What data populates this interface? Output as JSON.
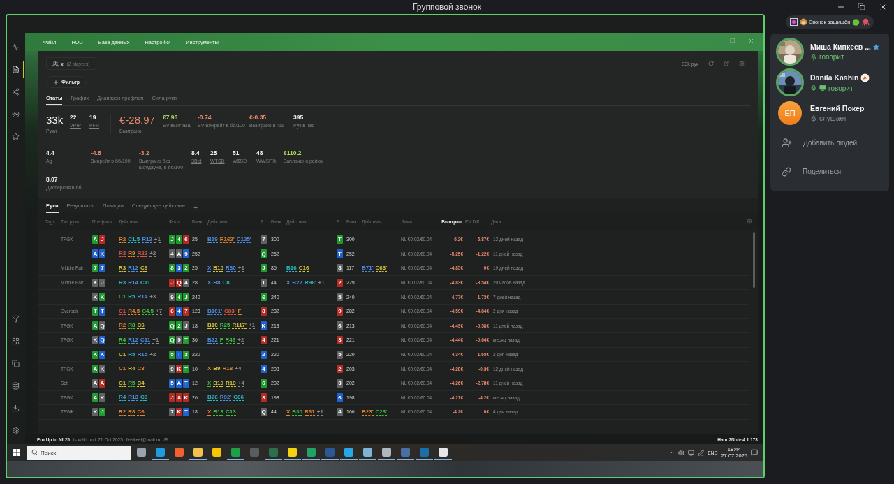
{
  "window": {
    "title": "Групповой звонок"
  },
  "sidebar": [
    {
      "kind": "chart",
      "selected": false
    },
    {
      "kind": "document",
      "selected": true
    },
    {
      "kind": "share",
      "selected": false
    },
    {
      "kind": "radio",
      "selected": false
    },
    {
      "kind": "star",
      "selected": false
    },
    {
      "kind": "filter",
      "selected": false
    },
    {
      "kind": "grid",
      "selected": false
    },
    {
      "kind": "copy",
      "selected": false
    },
    {
      "kind": "database",
      "selected": false
    },
    {
      "kind": "download",
      "selected": false
    },
    {
      "kind": "settings",
      "selected": false
    }
  ],
  "app": {
    "menu": [
      "Файл",
      "HUD",
      "База данных",
      "Настройки",
      "Инструменты"
    ],
    "player": {
      "name": "к.",
      "count": "(2 players)"
    },
    "hands_count": "33k рук",
    "filter_button": "Фильтр",
    "tabs": [
      {
        "label": "Статы",
        "selected": true
      },
      {
        "label": "График",
        "selected": false
      },
      {
        "label": "Диапазон префлоп",
        "selected": false
      },
      {
        "label": "Сила руки",
        "selected": false
      }
    ],
    "stats_rows": [
      [
        [
          {
            "value": "33k",
            "label": "Руки",
            "large": true,
            "color": "#f0f0f0",
            "underlined": false
          },
          {
            "value": "22",
            "label": "VPIP",
            "large": false,
            "color": "#f0f0f0",
            "underlined": true
          },
          {
            "value": "19",
            "label": "PFR",
            "large": false,
            "color": "#f0f0f0",
            "underlined": true
          }
        ],
        [
          {
            "value": "€-28.97",
            "label": "Выиграно",
            "large": true,
            "color": "#e8876c",
            "underlined": false
          },
          {
            "value": "€7.96",
            "label": "EV выигрыш",
            "large": false,
            "color": "#a8d95a",
            "underlined": false
          },
          {
            "value": "-0.74",
            "label": "EV Винрейт в бб/100",
            "large": false,
            "color": "#e8876c",
            "underlined": false
          },
          {
            "value": "€-0.35",
            "label": "Выиграно в час",
            "large": false,
            "color": "#e8876c",
            "underlined": false
          },
          {
            "value": "395",
            "label": "Рук в час",
            "large": false,
            "color": "#f0f0f0",
            "underlined": false
          }
        ]
      ],
      [
        [
          {
            "value": "4.4",
            "label": "Ag",
            "large": false,
            "color": "#f0f0f0",
            "underlined": false
          },
          {
            "value": "-4.8",
            "label": "Винрейт в бб/100",
            "large": false,
            "color": "#e8876c",
            "underlined": false
          },
          {
            "value": "-3.2",
            "label": "Выиграно без шоудауна, в бб/100",
            "large": false,
            "color": "#e8876c",
            "underlined": false
          },
          {
            "value": "8.4",
            "label": "3Bet",
            "large": false,
            "color": "#f0f0f0",
            "underlined": true
          },
          {
            "value": "28",
            "label": "WTSD",
            "large": false,
            "color": "#f0f0f0",
            "underlined": true
          },
          {
            "value": "51",
            "label": "W$SD",
            "large": false,
            "color": "#f0f0f0",
            "underlined": false
          },
          {
            "value": "48",
            "label": "WWSF%",
            "large": false,
            "color": "#f0f0f0",
            "underlined": false
          },
          {
            "value": "€110.2",
            "label": "Заплачено рейка",
            "large": false,
            "color": "#a8d95a",
            "underlined": false
          }
        ]
      ],
      [
        [
          {
            "value": "8.07",
            "label": "Дисперсия в бб",
            "large": false,
            "color": "#f0f0f0",
            "underlined": false
          }
        ]
      ]
    ]
  },
  "table": {
    "tabs": [
      {
        "label": "Руки",
        "selected": true
      },
      {
        "label": "Результаты",
        "selected": false
      },
      {
        "label": "Позиции",
        "selected": false
      },
      {
        "label": "Следующее действие",
        "selected": false
      }
    ],
    "add_tab": "+",
    "columns": [
      {
        "label": "Tags",
        "sorted": false
      },
      {
        "label": "Тип руки",
        "sorted": false
      },
      {
        "label": "Префлоп",
        "sorted": false
      },
      {
        "label": "Действия",
        "sorted": false
      },
      {
        "label": "Флоп",
        "sorted": false
      },
      {
        "label": "Банк",
        "sorted": false
      },
      {
        "label": "Действия",
        "sorted": false
      },
      {
        "label": "Т.",
        "sorted": false
      },
      {
        "label": "Банк",
        "sorted": false
      },
      {
        "label": "Действия",
        "sorted": false
      },
      {
        "label": "Р.",
        "sorted": false
      },
      {
        "label": "Банк",
        "sorted": false
      },
      {
        "label": "Действия",
        "sorted": false
      },
      {
        "label": "Лимит",
        "sorted": false
      },
      {
        "label": "Выиграл ↓",
        "sorted": true
      },
      {
        "label": "EV Diff",
        "sorted": false
      },
      {
        "label": "Дата",
        "sorted": false
      }
    ],
    "rows": [
      {
        "type": "TPGK",
        "hole": [
          {
            "rank": "A",
            "color": "#1f9a2e"
          },
          {
            "rank": "J",
            "color": "#b52a22"
          }
        ],
        "pre": [
          {
            "text": "R2",
            "color": "#e0842f"
          },
          {
            "text": "C1.5",
            "color": "#27b8c8"
          },
          {
            "text": "R12",
            "color": "#4d8ee6"
          },
          {
            "text": "+1",
            "color": "#8a8a8a"
          }
        ],
        "flop": [
          {
            "rank": "J",
            "color": "#1f9a2e"
          },
          {
            "rank": "4",
            "color": "#1f9a2e"
          },
          {
            "rank": "6",
            "color": "#b52a22"
          }
        ],
        "flop_pot": "25",
        "flop_act": [
          {
            "text": "B19",
            "color": "#4d8ee6"
          },
          {
            "text": "R162'",
            "color": "#e0842f"
          },
          {
            "text": "C125'",
            "color": "#4d8ee6"
          }
        ],
        "turn": {
          "rank": "7",
          "color": "#5f6163"
        },
        "turn_pot": "300",
        "river": {
          "rank": "T",
          "color": "#1f9a2e"
        },
        "river_pot": "300",
        "limit": "NL €0.02/€0.04",
        "won": "-6.2€",
        "ev_diff": "-6.87€",
        "date": "12 дней назад"
      },
      {
        "hole": [
          {
            "rank": "A",
            "color": "#1f62cf"
          },
          {
            "rank": "K",
            "color": "#1f62cf"
          }
        ],
        "pre": [
          {
            "text": "R3",
            "color": "#e0533f"
          },
          {
            "text": "R9",
            "color": "#e0842f"
          },
          {
            "text": "R22",
            "color": "#e0533f"
          },
          {
            "text": "+2",
            "color": "#8a8a8a"
          }
        ],
        "flop": [
          {
            "rank": "4",
            "color": "#5f6163"
          },
          {
            "rank": "A",
            "color": "#5f6163"
          },
          {
            "rank": "9",
            "color": "#1f62cf"
          }
        ],
        "flop_pot": "252",
        "turn": {
          "rank": "Q",
          "color": "#1f9a2e"
        },
        "turn_pot": "252",
        "river": {
          "rank": "T",
          "color": "#1f62cf"
        },
        "river_pot": "252",
        "limit": "NL €0.02/€0.04",
        "won": "-5.25€",
        "ev_diff": "-1.22€",
        "date": "11 дней назад"
      },
      {
        "type": "Middle Pair",
        "hole": [
          {
            "rank": "7",
            "color": "#1f9a2e"
          },
          {
            "rank": "7",
            "color": "#1f62cf"
          }
        ],
        "pre": [
          {
            "text": "R3",
            "color": "#d4c437"
          },
          {
            "text": "R12",
            "color": "#4d8ee6"
          },
          {
            "text": "C9",
            "color": "#d4c437"
          }
        ],
        "flop": [
          {
            "rank": "8",
            "color": "#1f9a2e"
          },
          {
            "rank": "3",
            "color": "#1f62cf"
          },
          {
            "rank": "2",
            "color": "#1f9a2e"
          }
        ],
        "flop_pot": "25",
        "flop_act": [
          {
            "text": "X",
            "color": "#4d8ee6"
          },
          {
            "text": "B15",
            "color": "#d4c437"
          },
          {
            "text": "R30",
            "color": "#4d8ee6"
          },
          {
            "text": "+1",
            "color": "#8a8a8a"
          }
        ],
        "turn": {
          "rank": "J",
          "color": "#1f9a2e"
        },
        "turn_pot": "85",
        "turn_act": [
          {
            "text": "B16",
            "color": "#27b8c8"
          },
          {
            "text": "C16",
            "color": "#d4c437"
          }
        ],
        "river": {
          "rank": "8",
          "color": "#5f6163"
        },
        "river_pot": "117",
        "river_act": [
          {
            "text": "B71'",
            "color": "#4d8ee6"
          },
          {
            "text": "C63'",
            "color": "#d4c437"
          }
        ],
        "limit": "NL €0.02/€0.04",
        "won": "-4.85€",
        "ev_diff": "0€",
        "date": "19 дней назад"
      },
      {
        "type": "Middle Pair",
        "hole": [
          {
            "rank": "K",
            "color": "#5f6163"
          },
          {
            "rank": "J",
            "color": "#5f6163"
          }
        ],
        "pre": [
          {
            "text": "R3",
            "color": "#27b8c8"
          },
          {
            "text": "R14",
            "color": "#4d8ee6"
          },
          {
            "text": "C11",
            "color": "#27b8c8"
          }
        ],
        "flop": [
          {
            "rank": "J",
            "color": "#b52a22"
          },
          {
            "rank": "Q",
            "color": "#b52a22"
          },
          {
            "rank": "4",
            "color": "#5f6163"
          }
        ],
        "flop_pot": "28",
        "flop_act": [
          {
            "text": "X",
            "color": "#4d8ee6"
          },
          {
            "text": "B8",
            "color": "#4d8ee6"
          },
          {
            "text": "C8",
            "color": "#27b8c8"
          }
        ],
        "turn": {
          "rank": "T",
          "color": "#5f6163"
        },
        "turn_pot": "44",
        "turn_act": [
          {
            "text": "X",
            "color": "#4d8ee6"
          },
          {
            "text": "B22",
            "color": "#4d8ee6"
          },
          {
            "text": "R98'",
            "color": "#27b8c8"
          },
          {
            "text": "+1",
            "color": "#8a8a8a"
          }
        ],
        "river": {
          "rank": "2",
          "color": "#b52a22"
        },
        "river_pot": "229",
        "limit": "NL €0.02/€0.04",
        "won": "-4.83€",
        "ev_diff": "-3.54€",
        "date": "20 часов назад"
      },
      {
        "hole": [
          {
            "rank": "K",
            "color": "#5f6163"
          },
          {
            "rank": "K",
            "color": "#1f9a2e"
          }
        ],
        "pre": [
          {
            "text": "C1",
            "color": "#3ec03e"
          },
          {
            "text": "R5",
            "color": "#27b8c8"
          },
          {
            "text": "R14",
            "color": "#4d8ee6"
          },
          {
            "text": "+3",
            "color": "#8a8a8a"
          }
        ],
        "flop": [
          {
            "rank": "9",
            "color": "#5f6163"
          },
          {
            "rank": "4",
            "color": "#1f9a2e"
          },
          {
            "rank": "J",
            "color": "#1f9a2e"
          }
        ],
        "flop_pot": "240",
        "turn": {
          "rank": "6",
          "color": "#1f9a2e"
        },
        "turn_pot": "240",
        "river": {
          "rank": "5",
          "color": "#5f6163"
        },
        "river_pot": "240",
        "limit": "NL €0.02/€0.04",
        "won": "-4.77€",
        "ev_diff": "-1.73€",
        "date": "7 дней назад"
      },
      {
        "type": "Overpair",
        "hole": [
          {
            "rank": "T",
            "color": "#1f9a2e"
          },
          {
            "rank": "T",
            "color": "#1f62cf"
          }
        ],
        "pre": [
          {
            "text": "C1",
            "color": "#e0533f"
          },
          {
            "text": "R4.5",
            "color": "#e0842f"
          },
          {
            "text": "C4.5",
            "color": "#3ec03e"
          },
          {
            "text": "+7",
            "color": "#8a8a8a"
          }
        ],
        "flop": [
          {
            "rank": "6",
            "color": "#b52a22"
          },
          {
            "rank": "4",
            "color": "#1f62cf"
          },
          {
            "rank": "7",
            "color": "#b52a22"
          }
        ],
        "flop_pot": "128",
        "flop_act": [
          {
            "text": "B101'",
            "color": "#4d8ee6"
          },
          {
            "text": "C83'",
            "color": "#e0533f"
          },
          {
            "text": "F",
            "color": "#e0842f"
          }
        ],
        "turn": {
          "rank": "8",
          "color": "#b52a22"
        },
        "turn_pot": "282",
        "river": {
          "rank": "9",
          "color": "#b52a22"
        },
        "river_pot": "282",
        "limit": "NL €0.02/€0.04",
        "won": "-4.59€",
        "ev_diff": "-4.84€",
        "date": "2 дня назад"
      },
      {
        "type": "TPGK",
        "hole": [
          {
            "rank": "A",
            "color": "#1f9a2e"
          },
          {
            "rank": "Q",
            "color": "#5f6163"
          }
        ],
        "pre": [
          {
            "text": "R2",
            "color": "#e0842f"
          },
          {
            "text": "R8",
            "color": "#3ec03e"
          },
          {
            "text": "C6",
            "color": "#d4c437"
          }
        ],
        "flop": [
          {
            "rank": "Q",
            "color": "#1f9a2e"
          },
          {
            "rank": "2",
            "color": "#1f9a2e"
          },
          {
            "rank": "J",
            "color": "#5f6163"
          }
        ],
        "flop_pot": "18",
        "flop_act": [
          {
            "text": "B10",
            "color": "#d4c437"
          },
          {
            "text": "R25",
            "color": "#3ec03e"
          },
          {
            "text": "R117'",
            "color": "#d4c437"
          },
          {
            "text": "+1",
            "color": "#8a8a8a"
          }
        ],
        "turn": {
          "rank": "K",
          "color": "#1f62cf"
        },
        "turn_pot": "213",
        "river": {
          "rank": "6",
          "color": "#5f6163"
        },
        "river_pot": "213",
        "limit": "NL €0.02/€0.04",
        "won": "-4.49€",
        "ev_diff": "-0.58€",
        "date": "11 дней назад"
      },
      {
        "type": "TPGK",
        "hole": [
          {
            "rank": "K",
            "color": "#5f6163"
          },
          {
            "rank": "Q",
            "color": "#1f62cf"
          }
        ],
        "pre": [
          {
            "text": "R4",
            "color": "#3ec03e"
          },
          {
            "text": "R12",
            "color": "#4d8ee6"
          },
          {
            "text": "C11",
            "color": "#4d8ee6"
          },
          {
            "text": "+1",
            "color": "#8a8a8a"
          }
        ],
        "flop": [
          {
            "rank": "Q",
            "color": "#1f9a2e"
          },
          {
            "rank": "9",
            "color": "#5f6163"
          },
          {
            "rank": "T",
            "color": "#1f9a2e"
          }
        ],
        "flop_pot": "36",
        "flop_act": [
          {
            "text": "B22",
            "color": "#4d8ee6"
          },
          {
            "text": "F",
            "color": "#3ec03e"
          },
          {
            "text": "R43",
            "color": "#3ec03e"
          },
          {
            "text": "+2",
            "color": "#8a8a8a"
          }
        ],
        "turn": {
          "rank": "4",
          "color": "#b52a22"
        },
        "turn_pot": "221",
        "river": {
          "rank": "3",
          "color": "#b52a22"
        },
        "river_pot": "221",
        "limit": "NL €0.02/€0.04",
        "won": "-4.44€",
        "ev_diff": "-0.64€",
        "date": "месяц назад"
      },
      {
        "hole": [
          {
            "rank": "K",
            "color": "#1f9a2e"
          },
          {
            "rank": "K",
            "color": "#1f62cf"
          }
        ],
        "pre": [
          {
            "text": "C1",
            "color": "#d4c437"
          },
          {
            "text": "R5",
            "color": "#27b8c8"
          },
          {
            "text": "R15",
            "color": "#4d8ee6"
          },
          {
            "text": "+2",
            "color": "#8a8a8a"
          }
        ],
        "flop": [
          {
            "rank": "5",
            "color": "#1f9a2e"
          },
          {
            "rank": "T",
            "color": "#1f62cf"
          },
          {
            "rank": "3",
            "color": "#1f9a2e"
          }
        ],
        "flop_pot": "220",
        "turn": {
          "rank": "2",
          "color": "#1f62cf"
        },
        "turn_pot": "220",
        "river": {
          "rank": "5",
          "color": "#5f6163"
        },
        "river_pot": "220",
        "limit": "NL €0.02/€0.04",
        "won": "-4.34€",
        "ev_diff": "-1.65€",
        "date": "2 дня назад"
      },
      {
        "type": "TPGK",
        "hole": [
          {
            "rank": "A",
            "color": "#1f9a2e"
          },
          {
            "rank": "K",
            "color": "#5f6163"
          }
        ],
        "pre": [
          {
            "text": "C1",
            "color": "#e0842f"
          },
          {
            "text": "R4",
            "color": "#d4c437"
          },
          {
            "text": "C3",
            "color": "#e0842f"
          }
        ],
        "flop": [
          {
            "rank": "9",
            "color": "#5f6163"
          },
          {
            "rank": "K",
            "color": "#b52a22"
          },
          {
            "rank": "T",
            "color": "#1f9a2e"
          }
        ],
        "flop_pot": "10",
        "flop_act": [
          {
            "text": "X",
            "color": "#e0842f"
          },
          {
            "text": "B9",
            "color": "#d4c437"
          },
          {
            "text": "R18",
            "color": "#e0842f"
          },
          {
            "text": "+4",
            "color": "#8a8a8a"
          }
        ],
        "turn": {
          "rank": "4",
          "color": "#1f62cf"
        },
        "turn_pot": "203",
        "river": {
          "rank": "2",
          "color": "#b52a22"
        },
        "river_pot": "203",
        "limit": "NL €0.02/€0.04",
        "won": "-4.28€",
        "ev_diff": "-0.3€",
        "date": "12 дней назад"
      },
      {
        "type": "Set",
        "hole": [
          {
            "rank": "A",
            "color": "#5f6163"
          },
          {
            "rank": "A",
            "color": "#b52a22"
          }
        ],
        "pre": [
          {
            "text": "C1",
            "color": "#d4c437"
          },
          {
            "text": "R5",
            "color": "#3ec03e"
          },
          {
            "text": "C4",
            "color": "#d4c437"
          }
        ],
        "flop": [
          {
            "rank": "5",
            "color": "#1f62cf"
          },
          {
            "rank": "A",
            "color": "#1f62cf"
          },
          {
            "rank": "T",
            "color": "#1f62cf"
          }
        ],
        "flop_pot": "12",
        "flop_act": [
          {
            "text": "X",
            "color": "#3ec03e"
          },
          {
            "text": "B10",
            "color": "#d4c437"
          },
          {
            "text": "R19",
            "color": "#d4c437"
          },
          {
            "text": "+4",
            "color": "#8a8a8a"
          }
        ],
        "turn": {
          "rank": "6",
          "color": "#1f9a2e"
        },
        "turn_pot": "202",
        "river": {
          "rank": "3",
          "color": "#5f6163"
        },
        "river_pot": "202",
        "limit": "NL €0.02/€0.04",
        "won": "-4.26€",
        "ev_diff": "-2.78€",
        "date": "11 дней назад"
      },
      {
        "type": "TPGK",
        "hole": [
          {
            "rank": "A",
            "color": "#1f9a2e"
          },
          {
            "rank": "K",
            "color": "#5f6163"
          }
        ],
        "pre": [
          {
            "text": "R4",
            "color": "#27b8c8"
          },
          {
            "text": "R13",
            "color": "#4d8ee6"
          },
          {
            "text": "C9",
            "color": "#27b8c8"
          }
        ],
        "flop": [
          {
            "rank": "J",
            "color": "#b52a22"
          },
          {
            "rank": "8",
            "color": "#b52a22"
          },
          {
            "rank": "K",
            "color": "#b52a22"
          }
        ],
        "flop_pot": "26",
        "flop_act": [
          {
            "text": "B26",
            "color": "#27b8c8"
          },
          {
            "text": "R92'",
            "color": "#4d8ee6"
          },
          {
            "text": "C66",
            "color": "#27b8c8"
          }
        ],
        "turn": {
          "rank": "3",
          "color": "#b52a22"
        },
        "turn_pot": "198",
        "river": {
          "rank": "6",
          "color": "#1f62cf"
        },
        "river_pot": "198",
        "limit": "NL €0.02/€0.04",
        "won": "-4.21€",
        "ev_diff": "-4.2€",
        "date": "месяц назад"
      },
      {
        "type": "TPWK",
        "hole": [
          {
            "rank": "K",
            "color": "#5f6163"
          },
          {
            "rank": "J",
            "color": "#1f9a2e"
          }
        ],
        "pre": [
          {
            "text": "R2",
            "color": "#e0842f"
          },
          {
            "text": "R8",
            "color": "#e0842f"
          },
          {
            "text": "C6",
            "color": "#e0842f"
          }
        ],
        "flop": [
          {
            "rank": "7",
            "color": "#5f6163"
          },
          {
            "rank": "K",
            "color": "#b52a22"
          },
          {
            "rank": "T",
            "color": "#1f62cf"
          }
        ],
        "flop_pot": "18",
        "flop_act": [
          {
            "text": "X",
            "color": "#e0842f"
          },
          {
            "text": "B13",
            "color": "#3ec03e"
          },
          {
            "text": "C13",
            "color": "#3ec03e"
          }
        ],
        "turn": {
          "rank": "Q",
          "color": "#5f6163"
        },
        "turn_pot": "44",
        "turn_act": [
          {
            "text": "X",
            "color": "#e0842f"
          },
          {
            "text": "B30",
            "color": "#3ec03e"
          },
          {
            "text": "R61",
            "color": "#e0842f"
          },
          {
            "text": "+1",
            "color": "#8a8a8a"
          }
        ],
        "river": {
          "rank": "4",
          "color": "#5f6163"
        },
        "river_pot": "166",
        "river_act": [
          {
            "text": "B23'",
            "color": "#e0842f"
          },
          {
            "text": "C23'",
            "color": "#3ec03e"
          }
        ],
        "limit": "NL €0.02/€0.04",
        "won": "-4.2€",
        "ev_diff": "0€",
        "date": "4 дня назад"
      }
    ]
  },
  "status_bar": {
    "license": "Pro Up to NL25",
    "license_note": "is valid until 21 Oct 2025",
    "email": "fetskeel@mail.ru",
    "version": "Hand2Note 4.1.173"
  },
  "taskbar": {
    "search_placeholder": "Поиск",
    "apps": [
      {
        "color": "#9aa3ad",
        "running": false
      },
      {
        "color": "#1f9be0",
        "running": true
      },
      {
        "color": "#f0622d",
        "running": false
      },
      {
        "color": "#f2c14e",
        "running": true
      },
      {
        "color": "#f7c600",
        "running": false
      },
      {
        "color": "#1fa048",
        "running": true
      },
      {
        "color": "#5a5d60",
        "running": false
      },
      {
        "color": "#2d6f4a",
        "running": true
      },
      {
        "color": "#f5d20f",
        "running": true
      },
      {
        "color": "#21a366",
        "running": true
      },
      {
        "color": "#2b5797",
        "running": true
      },
      {
        "color": "#27a7e7",
        "running": true
      },
      {
        "color": "#7fb3d5",
        "running": true
      },
      {
        "color": "#b0b7bd",
        "running": true
      },
      {
        "color": "#4a6fa5",
        "running": true
      },
      {
        "color": "#1b6fa8",
        "running": true
      },
      {
        "color": "#e6e6e6",
        "running": true
      }
    ],
    "language": "ENG",
    "time": "18:44",
    "date": "27.07.2025"
  },
  "call": {
    "security": "Звонок защищён",
    "participants": [
      {
        "name": "Миша Кипкеев ...",
        "status": "говорит",
        "speaking": true,
        "screen_sharing": false,
        "star": true
      },
      {
        "name": "Danila Kashin",
        "status": "говорит",
        "speaking": true,
        "screen_sharing": true,
        "star": false
      },
      {
        "name": "Евгений Покер",
        "status": "слушает",
        "speaking": false,
        "kind": "initials",
        "initials": "ЕП",
        "screen_sharing": false,
        "star": false
      }
    ],
    "actions": [
      {
        "kind": "add",
        "label": "Добавить людей"
      },
      {
        "kind": "share",
        "label": "Поделиться"
      }
    ]
  }
}
